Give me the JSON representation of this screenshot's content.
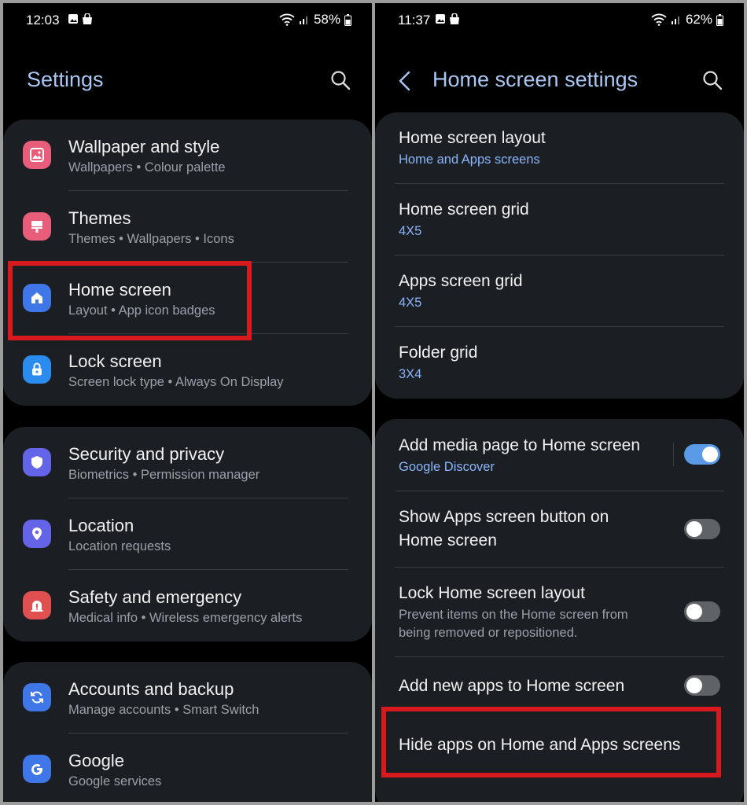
{
  "left": {
    "status": {
      "time": "12:03",
      "battery": "58%"
    },
    "title": "Settings",
    "groups": [
      [
        {
          "title": "Wallpaper and style",
          "subtitle": "Wallpapers  •  Colour palette",
          "icon": "wallpaper-icon",
          "color": "#e85d79"
        },
        {
          "title": "Themes",
          "subtitle": "Themes  •  Wallpapers  •  Icons",
          "icon": "themes-icon",
          "color": "#e85d79"
        },
        {
          "title": "Home screen",
          "subtitle": "Layout  •  App icon badges",
          "icon": "home-icon",
          "color": "#3f76e8"
        },
        {
          "title": "Lock screen",
          "subtitle": "Screen lock type  •  Always On Display",
          "icon": "lock-icon",
          "color": "#2b8cf0"
        }
      ],
      [
        {
          "title": "Security and privacy",
          "subtitle": "Biometrics  •  Permission manager",
          "icon": "shield-icon",
          "color": "#6464e8"
        },
        {
          "title": "Location",
          "subtitle": "Location requests",
          "icon": "location-icon",
          "color": "#6464e8"
        },
        {
          "title": "Safety and emergency",
          "subtitle": "Medical info  •  Wireless emergency alerts",
          "icon": "emergency-icon",
          "color": "#e05050"
        }
      ],
      [
        {
          "title": "Accounts and backup",
          "subtitle": "Manage accounts  •  Smart Switch",
          "icon": "sync-icon",
          "color": "#3f76e8"
        },
        {
          "title": "Google",
          "subtitle": "Google services",
          "icon": "google-icon",
          "color": "#3f76e8"
        }
      ]
    ]
  },
  "right": {
    "status": {
      "time": "11:37",
      "battery": "62%"
    },
    "title": "Home screen settings",
    "group1": [
      {
        "title": "Home screen layout",
        "subtitle": "Home and Apps screens"
      },
      {
        "title": "Home screen grid",
        "subtitle": "4X5"
      },
      {
        "title": "Apps screen grid",
        "subtitle": "4X5"
      },
      {
        "title": "Folder grid",
        "subtitle": "3X4"
      }
    ],
    "group2": [
      {
        "title": "Add media page to Home screen",
        "subtitle": "Google Discover",
        "toggle": true
      },
      {
        "title": "Show Apps screen button on\nHome screen",
        "toggle": false
      },
      {
        "title": "Lock Home screen layout",
        "subtitle": "Prevent items on the Home screen from\nbeing removed or repositioned.",
        "toggle": false
      },
      {
        "title": "Add new apps to Home screen",
        "toggle": false
      },
      {
        "title": "Hide apps on Home and Apps screens"
      }
    ]
  },
  "colors": {
    "accent": "#a9c7f2",
    "highlight": "#d8191e",
    "card": "#1b1f24",
    "link": "#8ab4f8"
  }
}
